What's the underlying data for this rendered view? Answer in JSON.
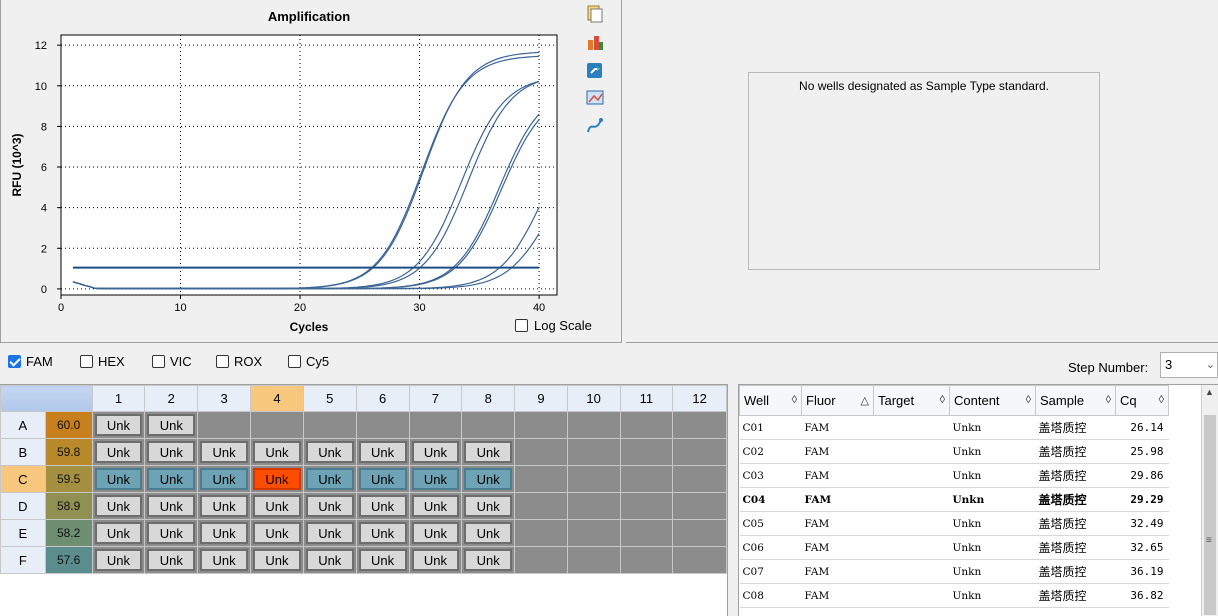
{
  "chart": {
    "title": "Amplification",
    "xlabel": "Cycles",
    "ylabel": "RFU (10^3)",
    "log_scale_label": "Log Scale",
    "log_scale_checked": false,
    "line_color": "#3b6596",
    "threshold_color": "#1f4e86"
  },
  "chart_data": {
    "type": "line",
    "title": "Amplification",
    "xlabel": "Cycles",
    "ylabel": "RFU (10^3)",
    "xlim": [
      0,
      41.5
    ],
    "ylim": [
      -0.3,
      12.5
    ],
    "xticks": [
      0,
      10,
      20,
      30,
      40
    ],
    "yticks": [
      0,
      2,
      4,
      6,
      8,
      10,
      12
    ],
    "grid": true,
    "threshold": 1.05,
    "x": [
      1,
      40
    ],
    "series": [
      {
        "cq": 26.14,
        "plateau": 11.7,
        "k": 0.55
      },
      {
        "cq": 25.98,
        "plateau": 11.5,
        "k": 0.55
      },
      {
        "cq": 29.86,
        "plateau": 10.6,
        "k": 0.55
      },
      {
        "cq": 29.29,
        "plateau": 10.5,
        "k": 0.55
      },
      {
        "cq": 32.49,
        "plateau": 10.0,
        "k": 0.55
      },
      {
        "cq": 32.65,
        "plateau": 9.8,
        "k": 0.55
      },
      {
        "cq": 36.19,
        "plateau": 9.0,
        "k": 0.55
      },
      {
        "cq": 36.82,
        "plateau": 7.5,
        "k": 0.55
      }
    ]
  },
  "toolbar_icons": [
    "copy-icon",
    "export-icon",
    "save-graph-icon",
    "print-icon",
    "chart-settings-icon"
  ],
  "standard_panel": {
    "message": "No wells designated as Sample Type standard."
  },
  "fluors": [
    {
      "label": "FAM",
      "checked": true
    },
    {
      "label": "HEX",
      "checked": false
    },
    {
      "label": "VIC",
      "checked": false
    },
    {
      "label": "ROX",
      "checked": false
    },
    {
      "label": "Cy5",
      "checked": false
    }
  ],
  "step": {
    "label": "Step Number:",
    "value": "3"
  },
  "plate": {
    "columns": [
      "1",
      "2",
      "3",
      "4",
      "5",
      "6",
      "7",
      "8",
      "9",
      "10",
      "11",
      "12"
    ],
    "selected_column": "4",
    "selected_row": "C",
    "rows": [
      {
        "label": "A",
        "temp": "60.0",
        "temp_color": "#c8801e",
        "wells": [
          "Unk",
          "Unk"
        ]
      },
      {
        "label": "B",
        "temp": "59.8",
        "temp_color": "#b88a2a",
        "wells": [
          "Unk",
          "Unk",
          "Unk",
          "Unk",
          "Unk",
          "Unk",
          "Unk",
          "Unk"
        ]
      },
      {
        "label": "C",
        "temp": "59.5",
        "temp_color": "#a59042",
        "wells": [
          "Unk",
          "Unk",
          "Unk",
          "Unk",
          "Unk",
          "Unk",
          "Unk",
          "Unk"
        ]
      },
      {
        "label": "D",
        "temp": "58.9",
        "temp_color": "#8f9052",
        "wells": [
          "Unk",
          "Unk",
          "Unk",
          "Unk",
          "Unk",
          "Unk",
          "Unk",
          "Unk"
        ]
      },
      {
        "label": "E",
        "temp": "58.2",
        "temp_color": "#6f8f72",
        "wells": [
          "Unk",
          "Unk",
          "Unk",
          "Unk",
          "Unk",
          "Unk",
          "Unk",
          "Unk"
        ]
      },
      {
        "label": "F",
        "temp": "57.6",
        "temp_color": "#5a8d8c",
        "wells": [
          "Unk",
          "Unk",
          "Unk",
          "Unk",
          "Unk",
          "Unk",
          "Unk",
          "Unk"
        ]
      }
    ]
  },
  "results": {
    "headers": [
      "Well",
      "Fluor",
      "Target",
      "Content",
      "Sample",
      "Cq"
    ],
    "sort_icons": [
      "◊",
      "△",
      "◊",
      "◊",
      "◊",
      "◊"
    ],
    "rows": [
      {
        "well": "C01",
        "fluor": "FAM",
        "target": "",
        "content": "Unkn",
        "sample": "盖塔质控",
        "cq": "26.14",
        "bold": false
      },
      {
        "well": "C02",
        "fluor": "FAM",
        "target": "",
        "content": "Unkn",
        "sample": "盖塔质控",
        "cq": "25.98",
        "bold": false
      },
      {
        "well": "C03",
        "fluor": "FAM",
        "target": "",
        "content": "Unkn",
        "sample": "盖塔质控",
        "cq": "29.86",
        "bold": false
      },
      {
        "well": "C04",
        "fluor": "FAM",
        "target": "",
        "content": "Unkn",
        "sample": "盖塔质控",
        "cq": "29.29",
        "bold": true
      },
      {
        "well": "C05",
        "fluor": "FAM",
        "target": "",
        "content": "Unkn",
        "sample": "盖塔质控",
        "cq": "32.49",
        "bold": false
      },
      {
        "well": "C06",
        "fluor": "FAM",
        "target": "",
        "content": "Unkn",
        "sample": "盖塔质控",
        "cq": "32.65",
        "bold": false
      },
      {
        "well": "C07",
        "fluor": "FAM",
        "target": "",
        "content": "Unkn",
        "sample": "盖塔质控",
        "cq": "36.19",
        "bold": false
      },
      {
        "well": "C08",
        "fluor": "FAM",
        "target": "",
        "content": "Unkn",
        "sample": "盖塔质控",
        "cq": "36.82",
        "bold": false
      }
    ]
  }
}
